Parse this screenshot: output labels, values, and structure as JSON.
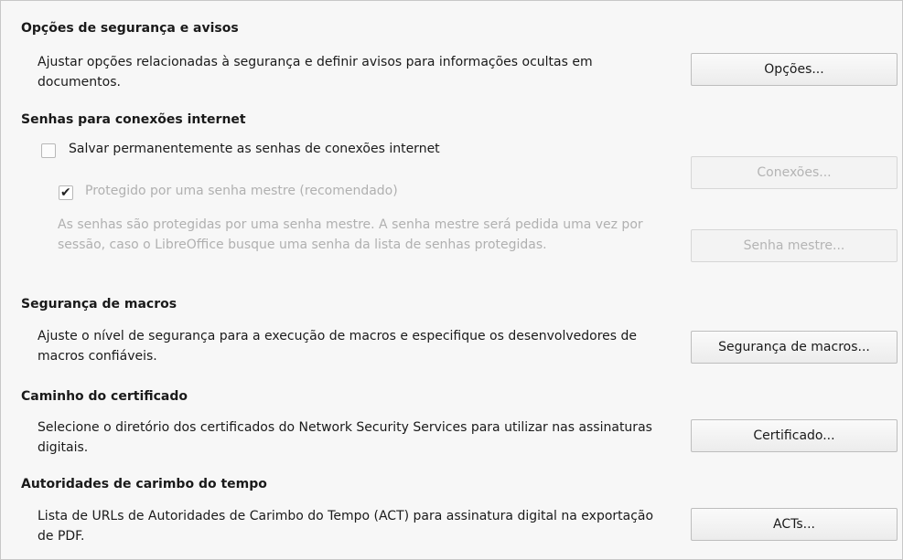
{
  "security_options": {
    "heading": "Opções de segurança e avisos",
    "description": "Ajustar opções relacionadas à segurança e definir avisos para informações ocultas em documentos.",
    "button_label": "Opções..."
  },
  "passwords": {
    "heading": "Senhas para conexões internet",
    "save_checkbox_label": "Salvar permanentemente as senhas de conexões internet",
    "save_checked": false,
    "master_checkbox_label": "Protegido por uma senha mestre (recomendado)",
    "master_checked": true,
    "description": "As senhas são protegidas por uma senha mestre. A senha mestre será pedida uma vez por sessão, caso o LibreOffice busque uma senha da lista de senhas protegidas.",
    "connections_button_label": "Conexões...",
    "master_password_button_label": "Senha mestre..."
  },
  "macro_security": {
    "heading": "Segurança de macros",
    "description": "Ajuste o nível de segurança para a execução de macros e especifique os desenvolvedores de macros confiáveis.",
    "button_label": "Segurança de macros..."
  },
  "certificate_path": {
    "heading": "Caminho do certificado",
    "description": "Selecione o diretório dos certificados do Network Security Services para utilizar nas assinaturas digitais.",
    "button_label": "Certificado..."
  },
  "tsa": {
    "heading": "Autoridades de carimbo do tempo",
    "description": "Lista de URLs de Autoridades de Carimbo do Tempo (ACT) para assinatura digital na exportação de PDF.",
    "button_label": "ACTs..."
  }
}
